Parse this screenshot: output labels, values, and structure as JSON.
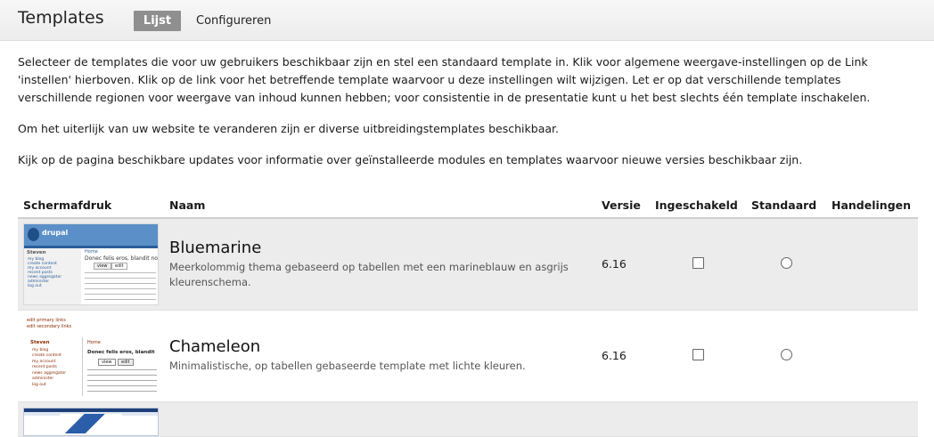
{
  "header": {
    "title": "Templates",
    "tabs": [
      {
        "label": "Lijst",
        "active": true
      },
      {
        "label": "Configureren",
        "active": false
      }
    ]
  },
  "intro": {
    "p1": "Selecteer de templates die voor uw gebruikers beschikbaar zijn en stel een standaard template in. Klik voor algemene weergave-instellingen op de Link 'instellen' hierboven. Klik op de link voor het betreffende template waarvoor u deze instellingen wilt wijzigen. Let er op dat verschillende templates verschillende regionen voor weergave van inhoud kunnen hebben; voor consistentie in de presentatie kunt u het best slechts één template inschakelen.",
    "p2": "Om het uiterlijk van uw website te veranderen zijn er diverse uitbreidingstemplates beschikbaar.",
    "p3": "Kijk op de pagina beschikbare updates voor informatie over geïnstalleerde modules en templates waarvoor nieuwe versies beschikbaar zijn."
  },
  "table": {
    "headers": {
      "screenshot": "Schermafdruk",
      "name": "Naam",
      "version": "Versie",
      "enabled": "Ingeschakeld",
      "default": "Standaard",
      "actions": "Handelingen"
    },
    "rows": [
      {
        "name": "Bluemarine",
        "description": "Meerkolommig thema gebaseerd op tabellen met een marineblauw en asgrijs kleurenschema.",
        "version": "6.16",
        "enabled": false,
        "default": false,
        "preview": {
          "logo": "drupal",
          "sidebar_heading": "Steven",
          "links": [
            "my blog",
            "create content",
            "my account",
            "recent posts",
            "news aggregator",
            "administer",
            "log out"
          ],
          "crumb": "Home",
          "headline": "Donec felis eros, blandit non",
          "tab_view": "view",
          "tab_edit": "edit"
        }
      },
      {
        "name": "Chameleon",
        "description": "Minimalistische, op tabellen gebaseerde template met lichte kleuren.",
        "version": "6.16",
        "enabled": false,
        "default": false,
        "preview": {
          "primary": "edit primary links",
          "secondary": "edit secondary links",
          "sidebar_heading": "Steven",
          "links": [
            "my blog",
            "create content",
            "my account",
            "recent posts",
            "news aggregator",
            "administer",
            "log out"
          ],
          "crumb": "Home",
          "headline": "Donec felis eros, blandit non",
          "tab_view": "view",
          "tab_edit": "edit"
        }
      }
    ]
  },
  "colors": {
    "bluemarine_header": "#5b8fc7",
    "chameleon_link": "#8a2c00",
    "row_shade": "#ececec"
  }
}
